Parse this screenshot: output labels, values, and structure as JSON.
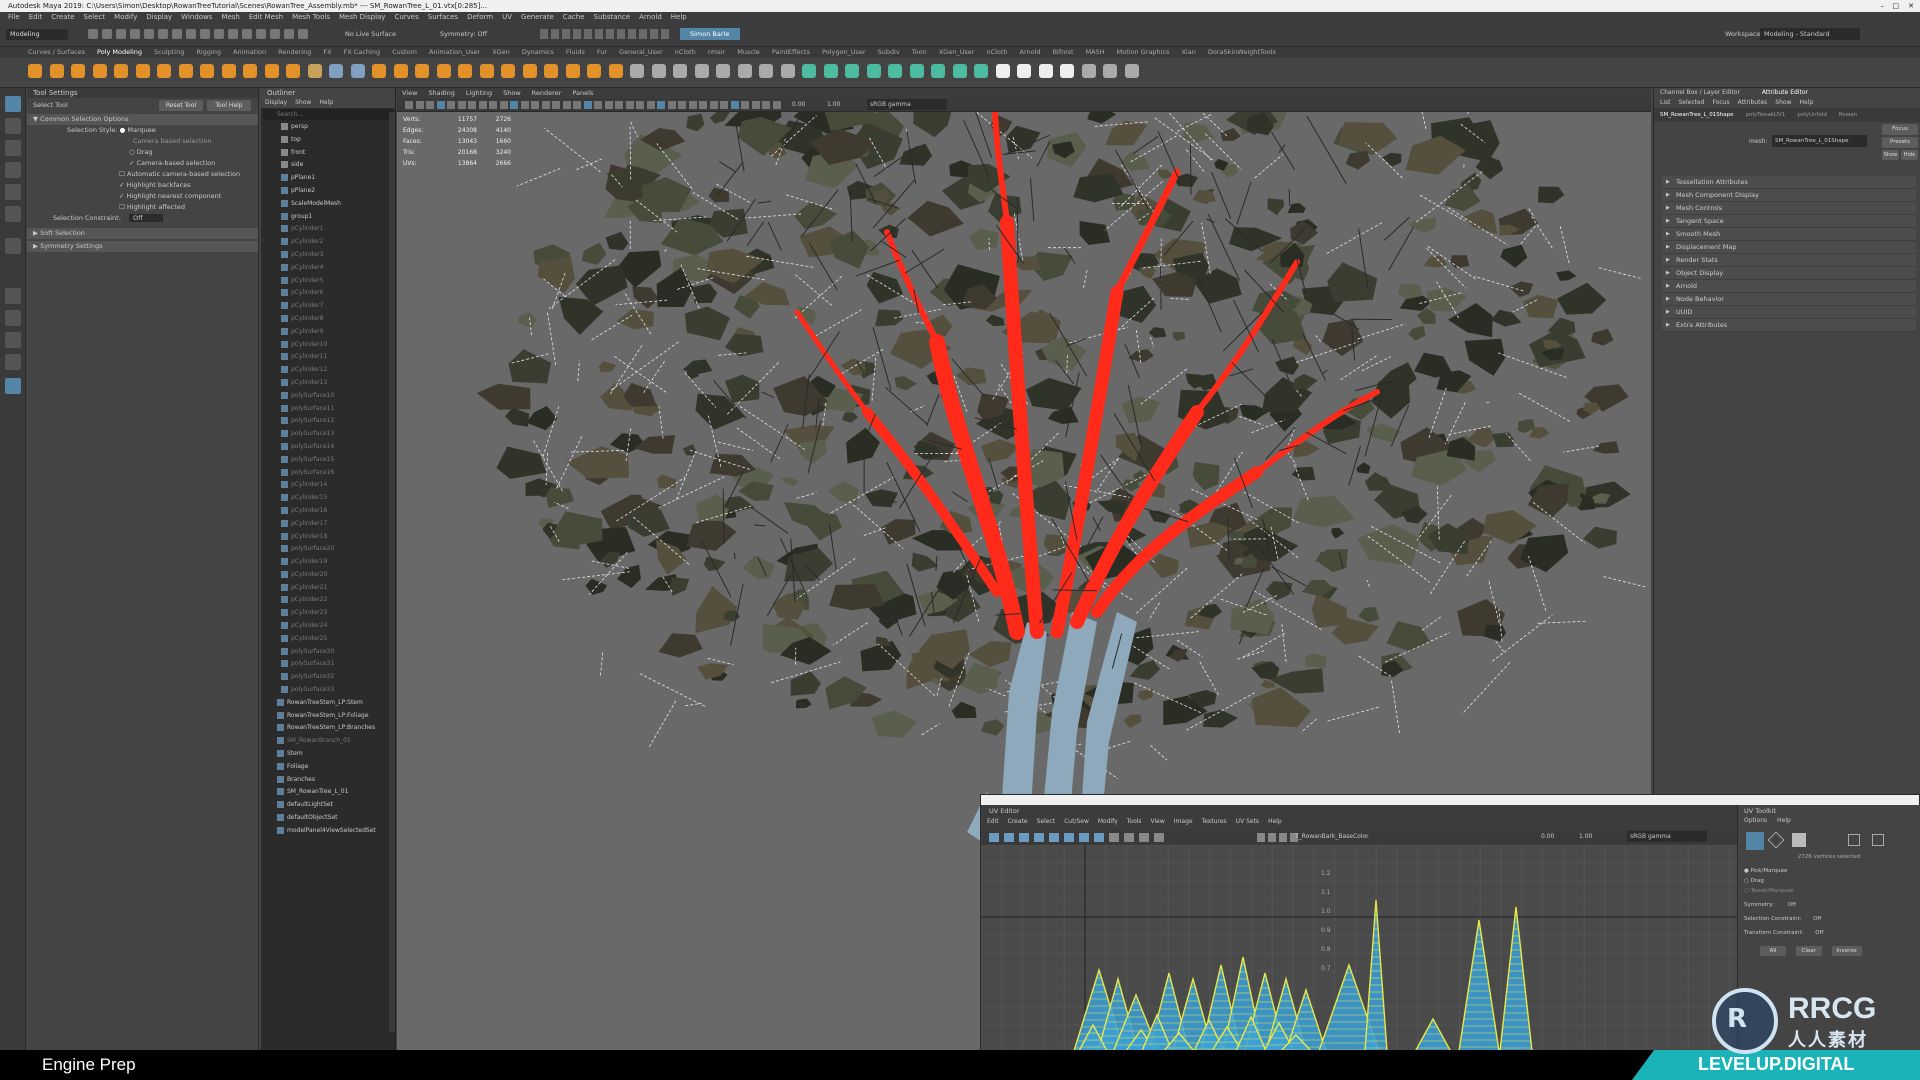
{
  "window": {
    "title": "Autodesk Maya 2019: C:\\Users\\Simon\\Desktop\\RowanTreeTutorial\\Scenes\\RowanTree_Assembly.mb* --- SM_RowanTree_L_01.vtx[0:285]...",
    "controls": [
      "–",
      "□",
      "✕"
    ]
  },
  "main_menu": [
    "File",
    "Edit",
    "Create",
    "Select",
    "Modify",
    "Display",
    "Windows",
    "Mesh",
    "Edit Mesh",
    "Mesh Tools",
    "Mesh Display",
    "Curves",
    "Surfaces",
    "Deform",
    "UV",
    "Generate",
    "Cache",
    "Substance",
    "Arnold",
    "Help"
  ],
  "status_line": {
    "mode": "Modeling",
    "live_surface": "No Live Surface",
    "symmetry": "Symmetry: Off",
    "user": "Simon Barle",
    "workspace_label": "Workspace:",
    "workspace_value": "Modeling - Standard"
  },
  "shelf_tabs": [
    "Curves / Surfaces",
    "Poly Modeling",
    "Sculpting",
    "Rigging",
    "Animation",
    "Rendering",
    "FX",
    "FX Caching",
    "Custom",
    "Animation_User",
    "XGen",
    "Dynamics",
    "Fluids",
    "Fur",
    "General_User",
    "nCloth",
    "nHair",
    "Muscle",
    "PaintEffects",
    "Polygon_User",
    "Subdiv",
    "Toon",
    "XGen_User",
    "nCloth",
    "Arnold",
    "Bifrost",
    "MASH",
    "Motion Graphics",
    "Xian",
    "DoraSkinWeightTools"
  ],
  "shelf_active_tab": "Poly Modeling",
  "tool_settings": {
    "header": "Tool Settings",
    "tool_name": "Select Tool",
    "reset": "Reset Tool",
    "help": "Tool Help",
    "sections": {
      "common": "Common Selection Options",
      "soft": "Soft Selection",
      "symmetry": "Symmetry Settings"
    },
    "selection_style_label": "Selection Style:",
    "options": [
      "Marquee",
      "Camera based selection",
      "Drag",
      "Camera-based selection",
      "Automatic camera-based selection",
      "Highlight backfaces",
      "Highlight nearest component",
      "Highlight affected"
    ],
    "constraint_label": "Selection Constraint:",
    "constraint_value": "Off"
  },
  "outliner": {
    "header": "Outliner",
    "menu": [
      "Display",
      "Show",
      "Help"
    ],
    "search_placeholder": "Search...",
    "items": [
      "persp",
      "top",
      "front",
      "side",
      "pPlane1",
      "pPlane2",
      "ScaleModelMesh",
      "group1",
      "pCylinder1",
      "pCylinder2",
      "pCylinder3",
      "pCylinder4",
      "pCylinder5",
      "pCylinder6",
      "pCylinder7",
      "pCylinder8",
      "pCylinder9",
      "pCylinder10",
      "pCylinder11",
      "pCylinder12",
      "pCylinder13",
      "polySurface10",
      "polySurface11",
      "polySurface12",
      "polySurface13",
      "polySurface14",
      "polySurface15",
      "polySurface16",
      "pCylinder14",
      "pCylinder15",
      "pCylinder16",
      "pCylinder17",
      "pCylinder18",
      "polySurface20",
      "pCylinder19",
      "pCylinder20",
      "pCylinder21",
      "pCylinder22",
      "pCylinder23",
      "pCylinder24",
      "pCylinder25",
      "polySurface30",
      "polySurface31",
      "polySurface32",
      "polySurface33",
      "RowanTreeStem_LP:Stem",
      "RowanTreeStem_LP:Foliage",
      "RowanTreeStem_LP:Branches",
      "SM_RowanBranch_01",
      "Stem",
      "Foliage",
      "Branches",
      "SM_RowanTree_L_01",
      "defaultLightSet",
      "defaultObjectSet",
      "modelPanel4ViewSelectedSet"
    ]
  },
  "viewport": {
    "menu": [
      "View",
      "Shading",
      "Lighting",
      "Show",
      "Renderer",
      "Panels"
    ],
    "hud": [
      {
        "label": "Verts:",
        "v1": "11757",
        "v2": "2726"
      },
      {
        "label": "Edges:",
        "v1": "24308",
        "v2": "4140"
      },
      {
        "label": "Faces:",
        "v1": "13043",
        "v2": "1660"
      },
      {
        "label": "Tris:",
        "v1": "20168",
        "v2": "3240"
      },
      {
        "label": "UVs:",
        "v1": "13864",
        "v2": "2666"
      }
    ],
    "exposure": "0.00",
    "gamma": "1.00",
    "color_space": "sRGB gamma"
  },
  "attribute_editor": {
    "tabs": [
      "Channel Box / Layer Editor",
      "Attribute Editor"
    ],
    "menu": [
      "List",
      "Selected",
      "Focus",
      "Attributes",
      "Show",
      "Help"
    ],
    "node_tabs": [
      "SM_RowanTree_L_01Shape",
      "polyTweakUV1",
      "polyUnfold",
      "Rowan"
    ],
    "mesh_label": "mesh:",
    "mesh_value": "SM_RowanTree_L_01Shape",
    "buttons": [
      "Focus",
      "Presets",
      "Show",
      "Hide"
    ],
    "sections": [
      "Tessellation Attributes",
      "Mesh Component Display",
      "Mesh Controls",
      "Tangent Space",
      "Smooth Mesh",
      "Displacement Map",
      "Render Stats",
      "Object Display",
      "Arnold",
      "Node Behavior",
      "UUID",
      "Extra Attributes"
    ]
  },
  "uv_editor": {
    "title": "UV Editor",
    "menu": [
      "Edit",
      "Create",
      "Select",
      "Cut/Sew",
      "Modify",
      "Tools",
      "View",
      "Image",
      "Textures",
      "UV Sets",
      "Help"
    ],
    "texture": "T_RowanBark_BaseColor",
    "exposure": "0.00",
    "gamma": "1.00",
    "color_space": "sRGB gamma",
    "grid_labels": [
      "1.2",
      "1.1",
      "1.0",
      "0.9",
      "0.8",
      "0.7"
    ]
  },
  "uv_toolkit": {
    "title": "UV Toolkit",
    "menu": [
      "Options",
      "Help"
    ],
    "count": "2726 vertices selected",
    "modes": [
      "Pick/Marquee",
      "Drag",
      "Tweak/Marquee"
    ],
    "symmetry_label": "Symmetry:",
    "symmetry_value": "Off",
    "sel_constraint_label": "Selection Constraint:",
    "sel_constraint_value": "Off",
    "transform_constraint_label": "Transform Constraint:",
    "transform_constraint_value": "Off",
    "buttons": [
      "All",
      "Clear",
      "Inverse"
    ]
  },
  "footer": {
    "chapter": "Engine Prep",
    "brand": "LEVELUP.DIGITAL",
    "watermark": "RRCG",
    "watermark_sub": "人人素材"
  },
  "colors": {
    "accent": "#5285a6",
    "highlight": "#ff2a1a",
    "uv_wire": "#e8e84a",
    "uv_fill": "#3aa0d8",
    "brand_bg": "#1ab3b8"
  }
}
